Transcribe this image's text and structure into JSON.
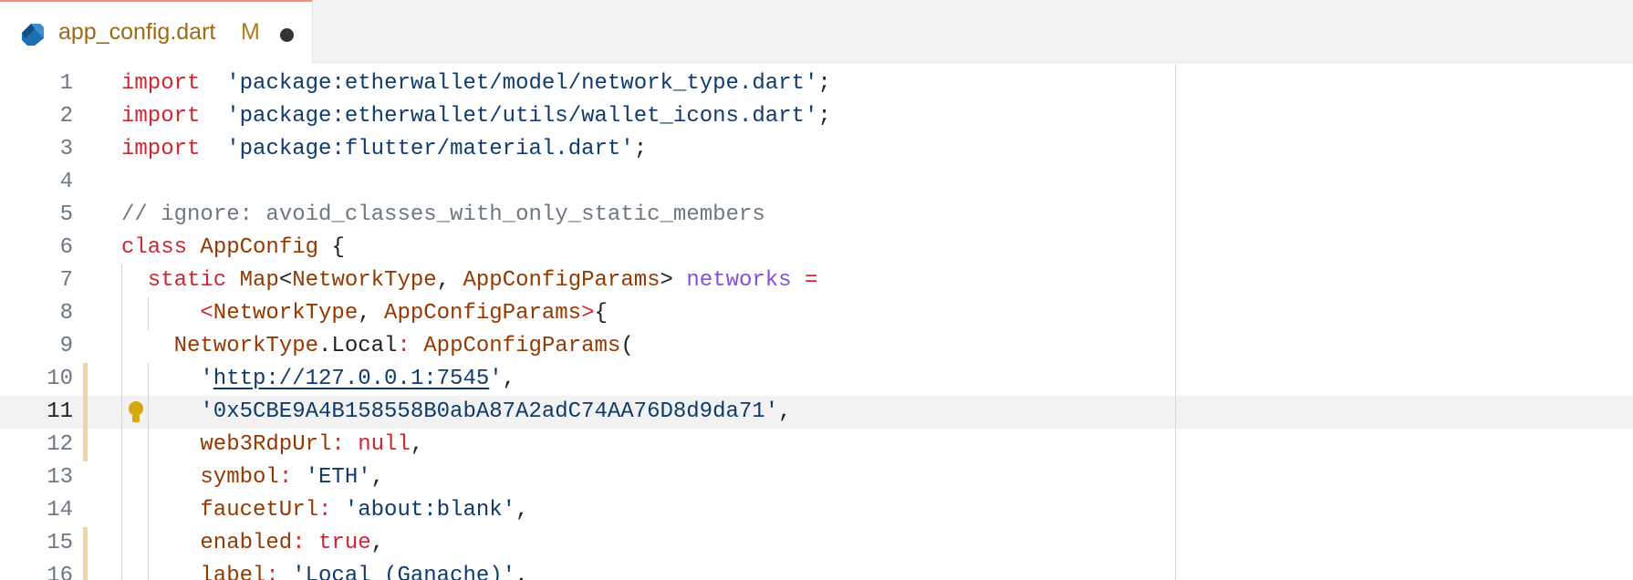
{
  "tab": {
    "filename": "app_config.dart",
    "status": "M",
    "file_icon": "dart-icon",
    "dirty_indicator": "unsaved-dot-icon"
  },
  "editor": {
    "current_line": 11,
    "lightbulb_icon": "lightbulb-icon",
    "lines": [
      {
        "n": "1",
        "mod": false,
        "indent": 0,
        "guides": 0,
        "tokens": [
          [
            "kw",
            "import"
          ],
          [
            "",
            "  "
          ],
          [
            "str",
            "'package:etherwallet/model/network_type.dart'"
          ],
          [
            "",
            ";"
          ]
        ]
      },
      {
        "n": "2",
        "mod": false,
        "indent": 0,
        "guides": 0,
        "tokens": [
          [
            "kw",
            "import"
          ],
          [
            "",
            "  "
          ],
          [
            "str",
            "'package:etherwallet/utils/wallet_icons.dart'"
          ],
          [
            "",
            ";"
          ]
        ]
      },
      {
        "n": "3",
        "mod": false,
        "indent": 0,
        "guides": 0,
        "tokens": [
          [
            "kw",
            "import"
          ],
          [
            "",
            "  "
          ],
          [
            "str",
            "'package:flutter/material.dart'"
          ],
          [
            "",
            ";"
          ]
        ]
      },
      {
        "n": "4",
        "mod": false,
        "indent": 0,
        "guides": 0,
        "tokens": []
      },
      {
        "n": "5",
        "mod": false,
        "indent": 0,
        "guides": 0,
        "tokens": [
          [
            "cm",
            "// ignore: avoid_classes_with_only_static_members"
          ]
        ]
      },
      {
        "n": "6",
        "mod": false,
        "indent": 0,
        "guides": 0,
        "tokens": [
          [
            "kw",
            "class"
          ],
          [
            "",
            " "
          ],
          [
            "cls",
            "AppConfig"
          ],
          [
            "",
            " {"
          ]
        ]
      },
      {
        "n": "7",
        "mod": false,
        "indent": 1,
        "guides": 1,
        "tokens": [
          [
            "kw",
            "static"
          ],
          [
            "",
            " "
          ],
          [
            "cls",
            "Map"
          ],
          [
            "",
            "<"
          ],
          [
            "cls",
            "NetworkType"
          ],
          [
            "",
            ", "
          ],
          [
            "cls",
            "AppConfigParams"
          ],
          [
            "",
            "> "
          ],
          [
            "var",
            "networks"
          ],
          [
            "",
            " "
          ],
          [
            "kw",
            "="
          ]
        ]
      },
      {
        "n": "8",
        "mod": false,
        "indent": 3,
        "guides": 2,
        "tokens": [
          [
            "kw",
            "<"
          ],
          [
            "cls",
            "NetworkType"
          ],
          [
            "",
            ", "
          ],
          [
            "cls",
            "AppConfigParams"
          ],
          [
            "kw",
            ">"
          ],
          [
            "",
            "{"
          ]
        ]
      },
      {
        "n": "9",
        "mod": false,
        "indent": 2,
        "guides": 1,
        "tokens": [
          [
            "cls",
            "NetworkType"
          ],
          [
            "",
            ".Local"
          ],
          [
            "kw",
            ":"
          ],
          [
            "",
            " "
          ],
          [
            "cls",
            "AppConfigParams"
          ],
          [
            "",
            "("
          ]
        ]
      },
      {
        "n": "10",
        "mod": true,
        "indent": 3,
        "guides": 2,
        "tokens": [
          [
            "str",
            "'"
          ],
          [
            "str ul",
            "http://127.0.0.1:7545"
          ],
          [
            "str",
            "'"
          ],
          [
            "",
            ","
          ]
        ]
      },
      {
        "n": "11",
        "mod": true,
        "indent": 3,
        "guides": 2,
        "tokens": [
          [
            "str",
            "'0x5CBE9A4B158558B0abA87A2adC74AA76D8d9da71'"
          ],
          [
            "",
            ","
          ]
        ]
      },
      {
        "n": "12",
        "mod": true,
        "indent": 3,
        "guides": 2,
        "tokens": [
          [
            "cls",
            "web3RdpUrl"
          ],
          [
            "kw",
            ":"
          ],
          [
            "",
            " "
          ],
          [
            "kw",
            "null"
          ],
          [
            "",
            ","
          ]
        ]
      },
      {
        "n": "13",
        "mod": false,
        "indent": 3,
        "guides": 2,
        "tokens": [
          [
            "cls",
            "symbol"
          ],
          [
            "kw",
            ":"
          ],
          [
            "",
            " "
          ],
          [
            "str",
            "'ETH'"
          ],
          [
            "",
            ","
          ]
        ]
      },
      {
        "n": "14",
        "mod": false,
        "indent": 3,
        "guides": 2,
        "tokens": [
          [
            "cls",
            "faucetUrl"
          ],
          [
            "kw",
            ":"
          ],
          [
            "",
            " "
          ],
          [
            "str",
            "'about:blank'"
          ],
          [
            "",
            ","
          ]
        ]
      },
      {
        "n": "15",
        "mod": true,
        "indent": 3,
        "guides": 2,
        "tokens": [
          [
            "cls",
            "enabled"
          ],
          [
            "kw",
            ":"
          ],
          [
            "",
            " "
          ],
          [
            "kw",
            "true"
          ],
          [
            "",
            ","
          ]
        ]
      },
      {
        "n": "16",
        "mod": true,
        "indent": 3,
        "guides": 2,
        "tokens": [
          [
            "cls",
            "label"
          ],
          [
            "kw",
            ":"
          ],
          [
            "",
            " "
          ],
          [
            "str",
            "'Local (Ganache)'"
          ],
          [
            "",
            ","
          ]
        ]
      }
    ]
  }
}
